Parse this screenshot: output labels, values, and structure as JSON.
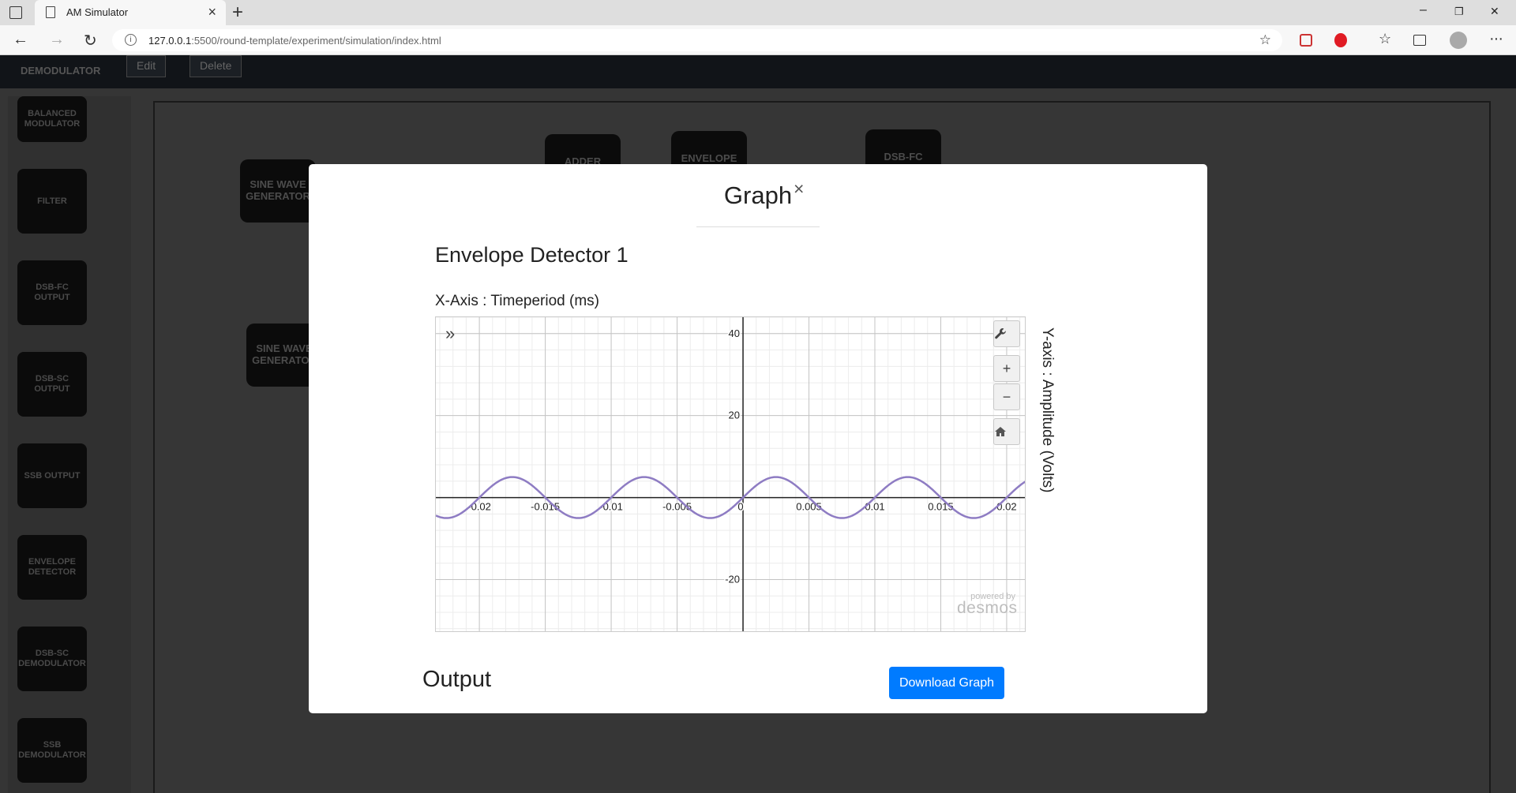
{
  "browser": {
    "tab_title": "AM Simulator",
    "tab_close": "×",
    "new_tab": "+",
    "url": "127.0.0.1:5500/round-template/experiment/simulation/index.html",
    "url_host": "127.0.0.1",
    "url_rest": ":5500/round-template/experiment/simulation/index.html",
    "win_minimize": "–",
    "win_restore": "❐",
    "win_close": "✕"
  },
  "app": {
    "logo": "DEMODULATOR",
    "edit_button": "Edit",
    "delete_button": "Delete",
    "sidebar": [
      "BALANCED MODULATOR",
      "FILTER",
      "DSB-FC OUTPUT",
      "DSB-SC OUTPUT",
      "SSB OUTPUT",
      "ENVELOPE DETECTOR",
      "DSB-SC DEMODULATOR",
      "SSB DEMODULATOR"
    ],
    "nodes": {
      "sine1": "SINE WAVE GENERATOR",
      "sine2": "SINE WAVE GENERATOR",
      "adder": "ADDER",
      "envelope": "ENVELOPE",
      "dsbfc": "DSB-FC"
    }
  },
  "modal": {
    "title": "Graph",
    "close": "×",
    "graph_name": "Envelope Detector 1",
    "x_axis_label": "X-Axis : Timeperiod (ms)",
    "y_axis_label": "Y-axis : Amplitude (Volts)",
    "expand_icon": "»",
    "zoom_in": "+",
    "zoom_out": "−",
    "watermark_small": "powered by",
    "watermark_large": "desmos",
    "output_label": "Output",
    "download_button": "Download Graph"
  },
  "chart_data": {
    "type": "line",
    "x_ticks": [
      -0.02,
      -0.015,
      -0.01,
      -0.005,
      0,
      0.005,
      0.01,
      0.015,
      0.02
    ],
    "x_tick_labels": [
      "-0.02",
      "-0.015",
      "-0.01",
      "-0.005",
      "0",
      "0.005",
      "0.01",
      "0.015",
      "0.02"
    ],
    "y_ticks": [
      40,
      20,
      -20
    ],
    "y_tick_labels": [
      "40",
      "20",
      "-20"
    ],
    "xlim": [
      -0.0233,
      0.0215
    ],
    "ylim": [
      -33,
      44
    ],
    "grid": true,
    "series": [
      {
        "function": "5*sin(2*pi*100*x)",
        "amplitude": 5,
        "frequency_hz": 100,
        "color": "#8e7cc3"
      }
    ]
  }
}
